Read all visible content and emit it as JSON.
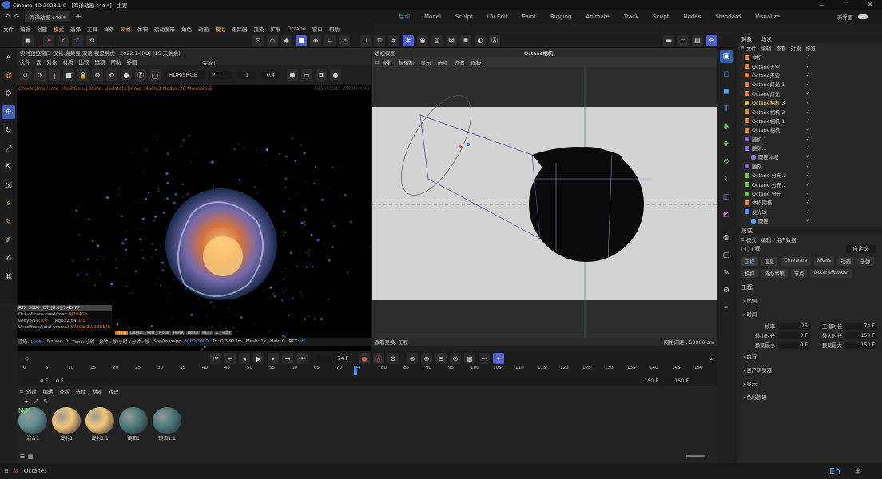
{
  "app": {
    "title": "Cinema 4D 2023.1.0 - [海洋动画.c4d *] - 主要",
    "doc_tab": "海洋动画.c4d *"
  },
  "menu": [
    "文件",
    "编辑",
    "创建",
    "模式",
    "选择",
    "工具",
    "样条",
    "网格",
    "体积",
    "运动图形",
    "角色",
    "动画",
    "模拟",
    "跟踪器",
    "渲染",
    "扩展",
    "Octane",
    "窗口",
    "帮助"
  ],
  "layouts": {
    "items": [
      "启动",
      "Model",
      "Sculpt",
      "UV Edit",
      "Paint",
      "Rigging",
      "Animate",
      "Track",
      "Script",
      "Nodes",
      "Standard",
      "Visualize"
    ],
    "active_index": 0,
    "new_interface": "新界面"
  },
  "toolbar": {
    "axis_x": "X",
    "axis_y": "Y",
    "axis_z": "Z"
  },
  "ir": {
    "title": "实时预览窗口 汉化:高荣强 双语:我是胖虎",
    "version": "2022.1-[R8] (15 天剩余)",
    "menu": [
      "文件",
      "云",
      "对象",
      "材质",
      "比较",
      "选项",
      "帮助",
      "界面"
    ],
    "status_right": "[完成]",
    "color_space": "HDR/sRGB",
    "mode": "PT",
    "value1": "1",
    "value2": "0.4",
    "status_line": "Check:2ms./1ms. MeshGen:135ms. Update[C]:0ms. Mesh:2 Nodes:39 Movable:3",
    "resolution": "1920*1080 ZOOM:%45",
    "gpu_line": "RTX 3080 (DT)[8.6]   %45   77",
    "ooc_label": "Out-of-core used/max:",
    "ooc_value": "0Kb/4Gb",
    "grey_label": "Grey8/16:",
    "grey_value": "0/0",
    "rgb_label": "Rgb32/64:",
    "rgb_value": "1/1",
    "vram_label": "Used/free/total vram:",
    "vram_value": "2.572Gb/1.913Gb/9.",
    "chips": [
      "Main",
      "DeMai",
      "Refr",
      "Nope",
      "ReflR",
      "ReflD",
      "RLID",
      "Z",
      "Post"
    ],
    "footer": {
      "render_label": "渲染:",
      "render_pct": "100%",
      "ms": "Ms/sec: 0",
      "time": "Time: 小时 : 分钟 : 秒/小时 : 分钟 : 秒",
      "spp_label": "Spp/maxspp:",
      "spp_value": "3000/3000",
      "tri": "Tri: 0/3.923m",
      "mesh": "Mesh: 1k",
      "hair": "Hair: 0",
      "rtx_label": "RTX:",
      "rtx_value": "off"
    }
  },
  "viewport": {
    "title": "透视视图",
    "camera": "Octane相机",
    "menu": [
      "查看",
      "摄像机",
      "显示",
      "选项",
      "过滤",
      "面板"
    ],
    "bottom_left": "查看变换: 工程",
    "grid_spacing": "网格间距 : 50000 cm"
  },
  "objects": {
    "tabs": [
      "对象",
      "场次"
    ],
    "menu": [
      "文件",
      "编辑",
      "查看",
      "对象",
      "标签"
    ],
    "items": [
      {
        "name": "体积",
        "color": "#e08a3a",
        "indent": 0
      },
      {
        "name": "Octane天空",
        "color": "#e08a3a",
        "indent": 0
      },
      {
        "name": "Octane天空",
        "color": "#e08a3a",
        "indent": 0
      },
      {
        "name": "Octane灯光.1",
        "color": "#e08a3a",
        "indent": 0
      },
      {
        "name": "Octane灯光",
        "color": "#e08a3a",
        "indent": 0
      },
      {
        "name": "Octane相机.3",
        "color": "#e0c040",
        "indent": 0,
        "selected": true
      },
      {
        "name": "Octane相机.2",
        "color": "#e08a3a",
        "indent": 0
      },
      {
        "name": "Octane相机.1",
        "color": "#e08a3a",
        "indent": 0
      },
      {
        "name": "Octane相机",
        "color": "#e08a3a",
        "indent": 0
      },
      {
        "name": "随机.1",
        "color": "#9a6ed8",
        "indent": 0
      },
      {
        "name": "雕刻.1",
        "color": "#9a6ed8",
        "indent": 0
      },
      {
        "name": "圆锥体域",
        "color": "#9a6ed8",
        "indent": 1
      },
      {
        "name": "雕刻",
        "color": "#9a6ed8",
        "indent": 0
      },
      {
        "name": "Octane 分布.2",
        "color": "#7bc94f",
        "indent": 0
      },
      {
        "name": "Octane 分布.1",
        "color": "#7bc94f",
        "indent": 0
      },
      {
        "name": "Octane 分布",
        "color": "#7bc94f",
        "indent": 0
      },
      {
        "name": "体积网格",
        "color": "#e08a3a",
        "indent": 0
      },
      {
        "name": "发光球",
        "color": "#4ea1ff",
        "indent": 0
      },
      {
        "name": "圆锥",
        "color": "#4ea1ff",
        "indent": 1
      }
    ]
  },
  "attributes": {
    "title": "属性",
    "menu": [
      "模式",
      "编辑",
      "用户数据"
    ],
    "section": "工程",
    "preset": "自定义",
    "tabs": [
      "工程",
      "信息",
      "Cineware",
      "XRefs",
      "动画",
      "子弹",
      "模拟",
      "待办事项",
      "节点",
      "OctaneRender"
    ],
    "active_tab": 0,
    "header": "工程",
    "groups": [
      "比例",
      "时间",
      "执行",
      "资产浏览器",
      "显示",
      "色彩管理"
    ],
    "fields": {
      "fps_label": "帧率",
      "fps": "25",
      "duration_label": "工程时长",
      "duration": "74 F",
      "min_label": "最小时长",
      "min": "0 F",
      "max_label": "最大时长",
      "max": "150 F",
      "pmin_label": "预览最小",
      "pmin": "0 F",
      "pmax_label": "预览最大",
      "pmax": "150 F"
    }
  },
  "timeline": {
    "current_frame": "74 F",
    "ruler": [
      "0",
      "5",
      "10",
      "15",
      "20",
      "25",
      "30",
      "35",
      "40",
      "45",
      "50",
      "55",
      "60",
      "65",
      "70",
      "74",
      "80",
      "85",
      "90",
      "95",
      "100",
      "105",
      "110",
      "115",
      "120",
      "125",
      "130",
      "135",
      "140",
      "145",
      "150"
    ],
    "start": "0 F",
    "start2": "0 F",
    "end": "150 F",
    "end2": "150 F",
    "playhead_frame": 74,
    "frame_count": 150
  },
  "materials": {
    "menu": [
      "创建",
      "编辑",
      "查看",
      "选择",
      "材质",
      "纹理"
    ],
    "items": [
      {
        "name": "混合1",
        "color": "#5f8f8f",
        "mix": "MIX"
      },
      {
        "name": "漫射1",
        "color": "#f3c777"
      },
      {
        "name": "漫射1.1",
        "color": "#f3c777"
      },
      {
        "name": "镜面1",
        "color": "#4d7b7b"
      },
      {
        "name": "镜面1.1",
        "color": "#4d7b7b"
      }
    ]
  },
  "statusbar": {
    "text": "Octane:",
    "ime": "En",
    "ime2": "半"
  },
  "colors": {
    "accent": "#3b8cf0",
    "orange": "#d77a1f"
  }
}
